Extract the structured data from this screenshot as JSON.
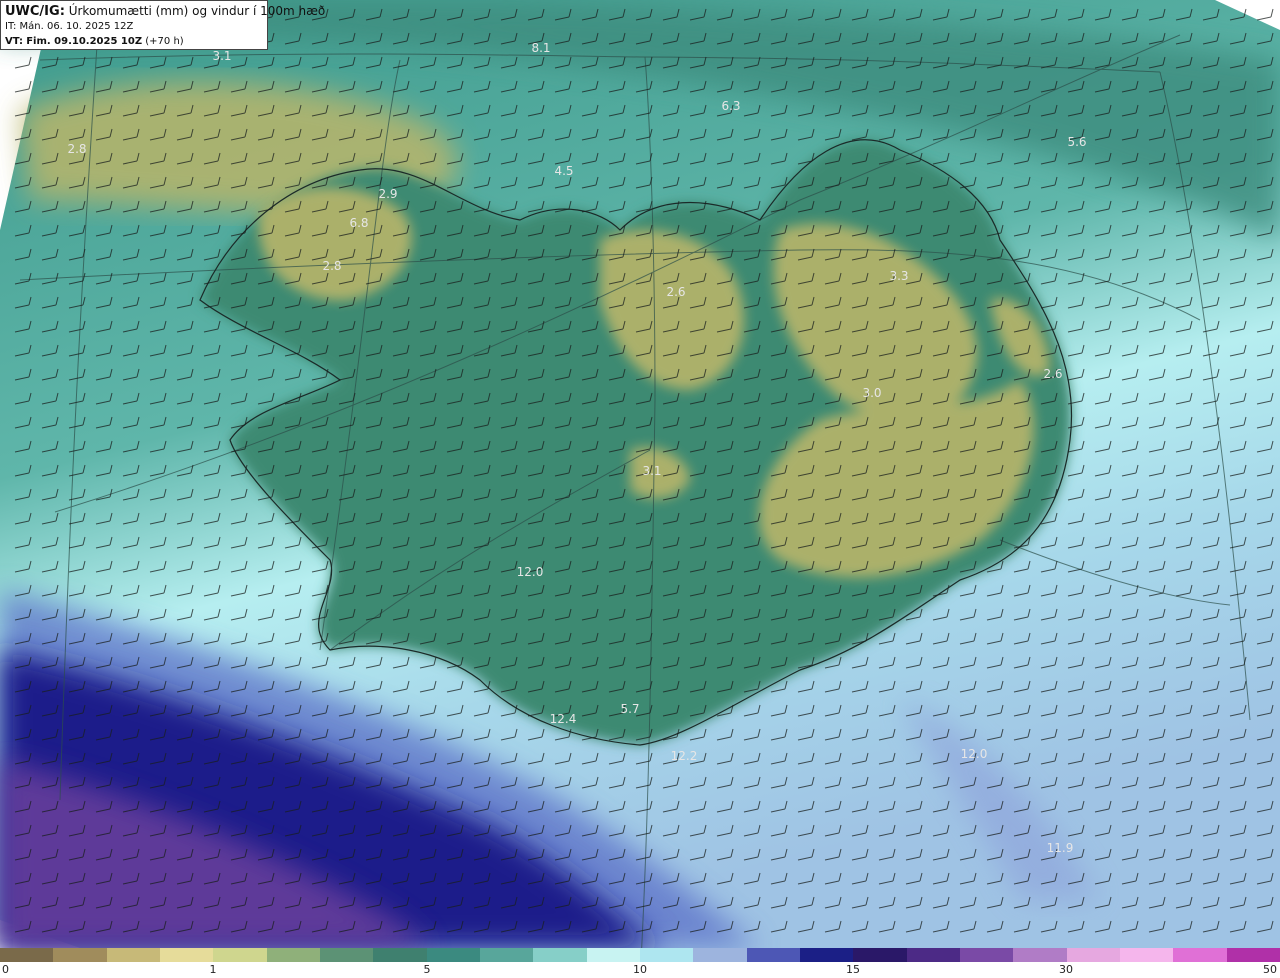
{
  "header": {
    "model": "UWC/IG:",
    "title": "Úrkomumætti (mm) og vindur í 100m hæð",
    "init_time": "IT: Mán. 06. 10. 2025 12Z",
    "valid_prefix": "VT:",
    "valid_time": "Fim. 09.10.2025 10Z",
    "lead_time": "(+70 h)"
  },
  "map_labels": [
    {
      "text": "3.1"
    },
    {
      "text": "8.1"
    },
    {
      "text": "6.3"
    },
    {
      "text": "5.6"
    },
    {
      "text": "2.8"
    },
    {
      "text": "4.5"
    },
    {
      "text": "2.9"
    },
    {
      "text": "6.8"
    },
    {
      "text": "2.8"
    },
    {
      "text": "2.6"
    },
    {
      "text": "3.3"
    },
    {
      "text": "3.0"
    },
    {
      "text": "2.6"
    },
    {
      "text": "3.1"
    },
    {
      "text": "12.0"
    },
    {
      "text": "12.4"
    },
    {
      "text": "5.7"
    },
    {
      "text": "12.2"
    },
    {
      "text": "12.0"
    },
    {
      "text": "11.9"
    }
  ],
  "colorbar": {
    "ticks": [
      "0",
      "1",
      "5",
      "10",
      "15",
      "30",
      "50"
    ],
    "colors": [
      "#7a6a4a",
      "#a08c5c",
      "#c7b978",
      "#e6dc9a",
      "#cfd68e",
      "#8fb07a",
      "#5c9275",
      "#3f806f",
      "#3b8a80",
      "#58a69b",
      "#86cfc8",
      "#c8f3f2",
      "#aee6f0",
      "#9db4de",
      "#4d57b5",
      "#1b1f86",
      "#2a1868",
      "#4c2a86",
      "#7a4aa6",
      "#b07cc6",
      "#e6a8e0",
      "#f5b6ec",
      "#e070d6",
      "#b030a8"
    ]
  },
  "colors": {
    "sea_green": "#3f9a8c",
    "land_yellow": "#b8b56a",
    "light_cyan": "#b6eef0",
    "deep_blue": "#1d1f8a",
    "purple": "#6a3f9c"
  }
}
